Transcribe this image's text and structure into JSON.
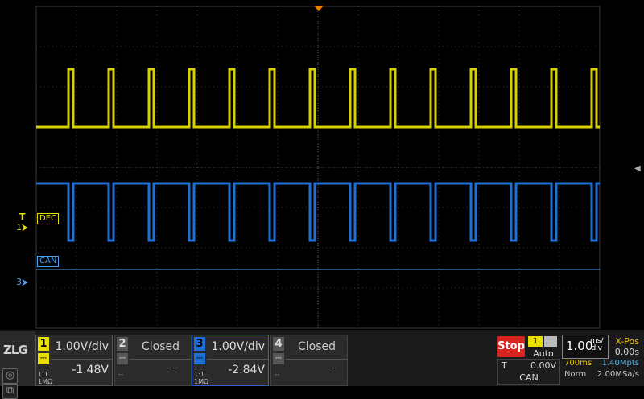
{
  "waveform": {
    "ch1_label": "DEC",
    "ch3_label": "CAN",
    "trigger_marker": "T",
    "ch1_marker": "1",
    "ch3_marker": "3",
    "colors": {
      "ch1": "#d9d200",
      "ch3": "#1e6fd8",
      "grid": "#3a3a3a",
      "trigger_pos": "#f08000"
    }
  },
  "logo": {
    "text": "ZLG",
    "icons": [
      "camera-icon",
      "screenshot-icon"
    ]
  },
  "channels": [
    {
      "num": "1",
      "scale": "1.00V/div",
      "offset": "-1.48V",
      "impedance": "1:1\n1MΩ",
      "state": "on"
    },
    {
      "num": "2",
      "status": "Closed",
      "dash": "--",
      "dash2": "--",
      "state": "off"
    },
    {
      "num": "3",
      "scale": "1.00V/div",
      "offset": "-2.84V",
      "impedance": "1:1\n1MΩ",
      "state": "on"
    },
    {
      "num": "4",
      "status": "Closed",
      "dash": "--",
      "dash2": "--",
      "state": "off"
    }
  ],
  "run": {
    "label": "Stop"
  },
  "trigger": {
    "source": "1",
    "mode": "Auto",
    "label": "T",
    "level": "0.00V",
    "type": "CAN"
  },
  "timebase": {
    "value": "1.00",
    "unit_top": "ms/",
    "unit_bottom": "div",
    "xpos_label": "X-Pos",
    "xpos_value": "0.00s",
    "mem_depth": "700ms",
    "points": "1.40Mpts",
    "acq_mode": "Norm",
    "sample_rate": "2.00MSa/s"
  }
}
